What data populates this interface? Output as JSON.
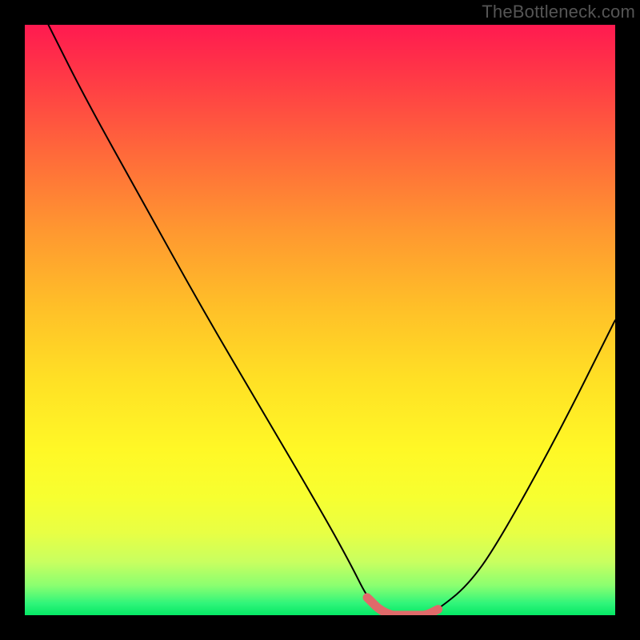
{
  "watermark": "TheBottleneck.com",
  "chart_data": {
    "type": "line",
    "title": "",
    "xlabel": "",
    "ylabel": "",
    "xlim": [
      0,
      100
    ],
    "ylim": [
      0,
      100
    ],
    "series": [
      {
        "name": "bottleneck-curve",
        "x": [
          4,
          10,
          20,
          30,
          40,
          50,
          55,
          58,
          60,
          62,
          65,
          68,
          70,
          75,
          80,
          90,
          100
        ],
        "values": [
          100,
          88,
          70,
          52,
          35,
          18,
          9,
          3,
          1,
          0,
          0,
          0,
          1,
          5,
          12,
          30,
          50
        ]
      }
    ],
    "highlight_range_x": [
      58,
      70
    ],
    "gradient_top_color": "#ff1a50",
    "gradient_bottom_color": "#05e865",
    "curve_color": "#000000",
    "highlight_color": "#e06a6a"
  }
}
